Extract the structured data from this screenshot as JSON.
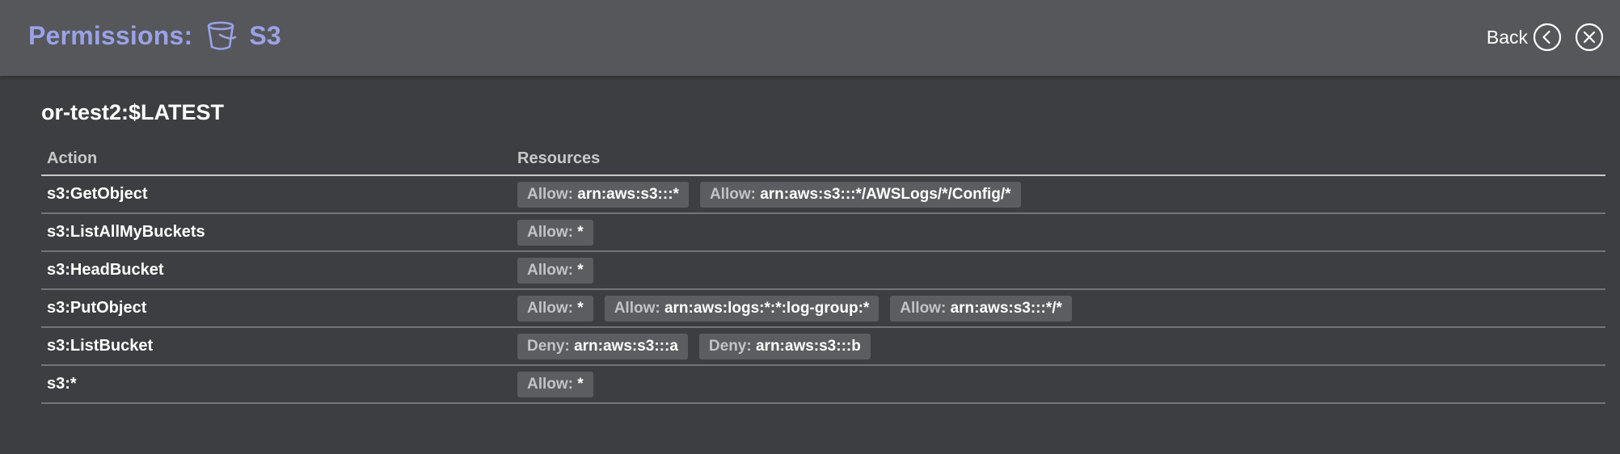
{
  "header": {
    "title_prefix": "Permissions:",
    "service_name": "S3",
    "service_icon": "bucket-icon",
    "back_label": "Back",
    "back_icon": "chevron-left-circle-icon",
    "close_icon": "close-circle-icon",
    "accent_color": "#9aa2e6"
  },
  "function_name": "or-test2:$LATEST",
  "table": {
    "columns": [
      "Action",
      "Resources"
    ],
    "rows": [
      {
        "action": "s3:GetObject",
        "resources": [
          {
            "effect": "Allow:",
            "arn": "arn:aws:s3:::*"
          },
          {
            "effect": "Allow:",
            "arn": "arn:aws:s3:::*/AWSLogs/*/Config/*"
          }
        ]
      },
      {
        "action": "s3:ListAllMyBuckets",
        "resources": [
          {
            "effect": "Allow:",
            "arn": "*"
          }
        ]
      },
      {
        "action": "s3:HeadBucket",
        "resources": [
          {
            "effect": "Allow:",
            "arn": "*"
          }
        ]
      },
      {
        "action": "s3:PutObject",
        "resources": [
          {
            "effect": "Allow:",
            "arn": "*"
          },
          {
            "effect": "Allow:",
            "arn": "arn:aws:logs:*:*:log-group:*"
          },
          {
            "effect": "Allow:",
            "arn": "arn:aws:s3:::*/*"
          }
        ]
      },
      {
        "action": "s3:ListBucket",
        "resources": [
          {
            "effect": "Deny:",
            "arn": "arn:aws:s3:::a"
          },
          {
            "effect": "Deny:",
            "arn": "arn:aws:s3:::b"
          }
        ]
      },
      {
        "action": "s3:*",
        "resources": [
          {
            "effect": "Allow:",
            "arn": "*"
          }
        ]
      }
    ]
  }
}
